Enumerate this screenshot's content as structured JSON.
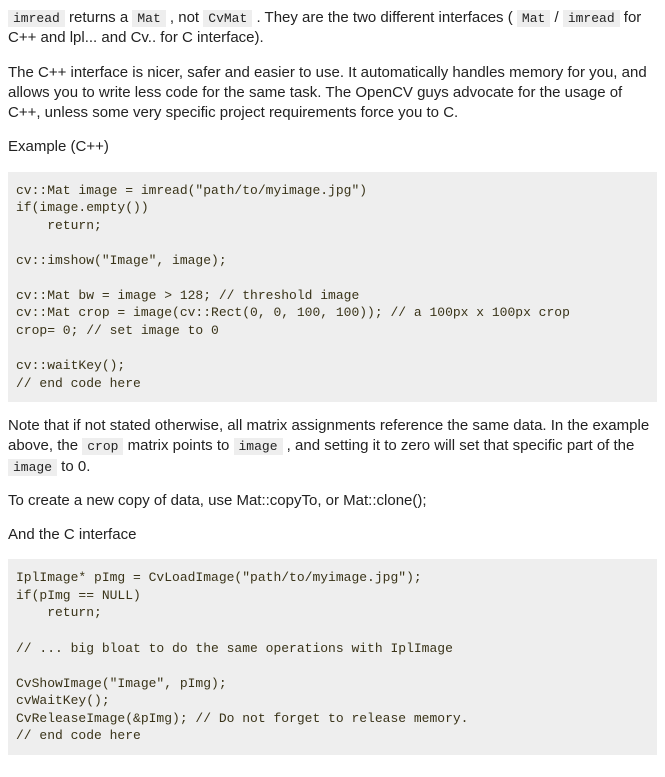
{
  "para1": {
    "c1": "imread",
    "t1": " returns a ",
    "c2": "Mat",
    "t2": " , not ",
    "c3": "CvMat",
    "t3": " . They are the two different interfaces ( ",
    "c4": "Mat",
    "t4": " / ",
    "c5": "imread",
    "t5": " for C++ and lpl... and Cv.. for C interface)."
  },
  "para2": "The C++ interface is nicer, safer and easier to use. It automatically handles memory for you, and allows you to write less code for the same task. The OpenCV guys advocate for the usage of C++, unless some very specific project requirements force you to C.",
  "para3": "Example (C++)",
  "code1": "cv::Mat image = imread(\"path/to/myimage.jpg\")\nif(image.empty())\n    return;\n\ncv::imshow(\"Image\", image);\n\ncv::Mat bw = image > 128; // threshold image\ncv::Mat crop = image(cv::Rect(0, 0, 100, 100)); // a 100px x 100px crop\ncrop= 0; // set image to 0\n\ncv::waitKey();\n// end code here",
  "para4": {
    "t1": "Note that if not stated otherwise, all matrix assignments reference the same data. In the example above, the ",
    "c1": "crop",
    "t2": " matrix points to ",
    "c2": "image",
    "t3": " , and setting it to zero will set that specific part of the ",
    "c3": "image",
    "t4": " to 0."
  },
  "para5": "To create a new copy of data, use Mat::copyTo, or Mat::clone();",
  "para6": "And the C interface",
  "code2": "IplImage* pImg = CvLoadImage(\"path/to/myimage.jpg\");\nif(pImg == NULL)\n    return;\n\n// ... big bloat to do the same operations with IplImage\n\nCvShowImage(\"Image\", pImg);\ncvWaitKey();\nCvReleaseImage(&pImg); // Do not forget to release memory.\n// end code here"
}
